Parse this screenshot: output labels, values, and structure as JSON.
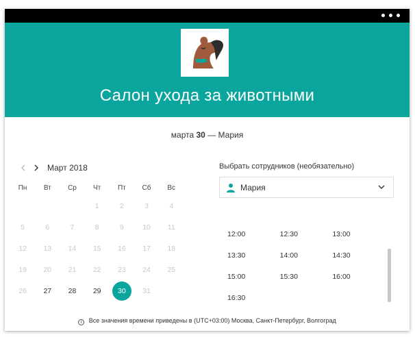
{
  "header": {
    "title": "Салон ухода за животными",
    "colors": {
      "accent": "#0aa59c",
      "titlebar": "#000000"
    },
    "logo_icon": "dog-logo-icon"
  },
  "summary": {
    "date_prefix": "марта",
    "day": "30",
    "separator": "—",
    "staff": "Мария"
  },
  "calendar": {
    "prev_icon": "chevron-left-icon",
    "next_icon": "chevron-right-icon",
    "month": "Март",
    "year": "2018",
    "weekdays": [
      "Пн",
      "Вт",
      "Ср",
      "Чт",
      "Пт",
      "Сб",
      "Вс"
    ],
    "weeks": [
      [
        {
          "d": "",
          "s": "empty"
        },
        {
          "d": "",
          "s": "empty"
        },
        {
          "d": "",
          "s": "empty"
        },
        {
          "d": "1",
          "s": "disabled"
        },
        {
          "d": "2",
          "s": "disabled"
        },
        {
          "d": "3",
          "s": "disabled"
        },
        {
          "d": "4",
          "s": "disabled"
        }
      ],
      [
        {
          "d": "5",
          "s": "disabled"
        },
        {
          "d": "6",
          "s": "disabled"
        },
        {
          "d": "7",
          "s": "disabled"
        },
        {
          "d": "8",
          "s": "disabled"
        },
        {
          "d": "9",
          "s": "disabled"
        },
        {
          "d": "10",
          "s": "disabled"
        },
        {
          "d": "11",
          "s": "disabled"
        }
      ],
      [
        {
          "d": "12",
          "s": "disabled"
        },
        {
          "d": "13",
          "s": "disabled"
        },
        {
          "d": "14",
          "s": "disabled"
        },
        {
          "d": "15",
          "s": "disabled"
        },
        {
          "d": "16",
          "s": "disabled"
        },
        {
          "d": "17",
          "s": "disabled"
        },
        {
          "d": "18",
          "s": "disabled"
        }
      ],
      [
        {
          "d": "19",
          "s": "disabled"
        },
        {
          "d": "20",
          "s": "disabled"
        },
        {
          "d": "21",
          "s": "disabled"
        },
        {
          "d": "22",
          "s": "disabled"
        },
        {
          "d": "23",
          "s": "disabled"
        },
        {
          "d": "24",
          "s": "disabled"
        },
        {
          "d": "25",
          "s": "disabled"
        }
      ],
      [
        {
          "d": "26",
          "s": "disabled"
        },
        {
          "d": "27",
          "s": "enabled"
        },
        {
          "d": "28",
          "s": "enabled"
        },
        {
          "d": "29",
          "s": "enabled"
        },
        {
          "d": "30",
          "s": "selected"
        },
        {
          "d": "31",
          "s": "disabled"
        },
        {
          "d": "",
          "s": "empty"
        }
      ]
    ]
  },
  "staff_picker": {
    "label": "Выбрать сотрудников (необязательно)",
    "selected": "Мария",
    "icon": "person-icon",
    "dropdown_icon": "chevron-down-icon"
  },
  "times": [
    [
      "12:00",
      "12:30",
      "13:00"
    ],
    [
      "13:30",
      "14:00",
      "14:30"
    ],
    [
      "15:00",
      "15:30",
      "16:00"
    ],
    [
      "16:30"
    ]
  ],
  "timezone": {
    "icon": "info-icon",
    "text": "Все значения времени приведены в (UTC+03:00) Москва, Санкт-Петербург, Волгоград"
  }
}
